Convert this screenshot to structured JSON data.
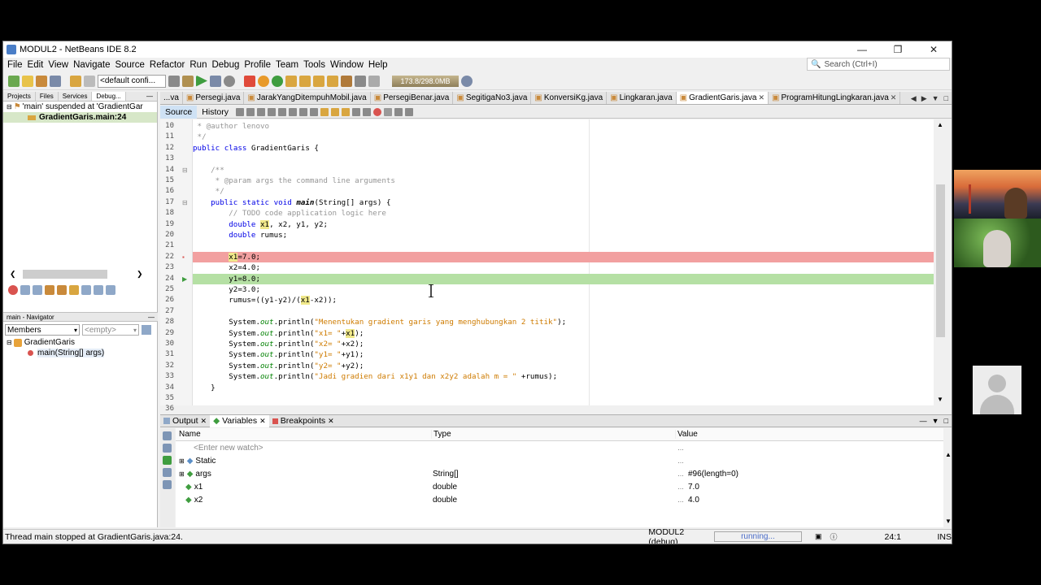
{
  "window": {
    "title": "MODUL2 - NetBeans IDE 8.2",
    "controls": [
      "—",
      "❐",
      "✕"
    ]
  },
  "menu": [
    "File",
    "Edit",
    "View",
    "Navigate",
    "Source",
    "Refactor",
    "Run",
    "Debug",
    "Profile",
    "Team",
    "Tools",
    "Window",
    "Help"
  ],
  "search": {
    "placeholder": "Search (Ctrl+I)"
  },
  "toolbar": {
    "config": "<default confi...",
    "memory": "173.8/298.0MB"
  },
  "left_panel": {
    "tabs": [
      "Projects",
      "Files",
      "Services",
      "Debug..."
    ],
    "debug_items": [
      "'main' suspended at 'GradientGar",
      "GradientGaris.main:24"
    ],
    "navigator_title": "main - Navigator",
    "members_label": "Members",
    "filter_placeholder": "<empty>",
    "nav_items": [
      "GradientGaris",
      "main(String[] args)"
    ]
  },
  "editor": {
    "tabs": [
      {
        "label": "...va",
        "active": false
      },
      {
        "label": "Persegi.java",
        "active": false
      },
      {
        "label": "JarakYangDitempuhMobil.java",
        "active": false
      },
      {
        "label": "PersegiBenar.java",
        "active": false
      },
      {
        "label": "SegitigaNo3.java",
        "active": false
      },
      {
        "label": "KonversiKg.java",
        "active": false
      },
      {
        "label": "Lingkaran.java",
        "active": false
      },
      {
        "label": "GradientGaris.java",
        "active": true
      },
      {
        "label": "ProgramHitungLingkaran.java",
        "active": false
      }
    ],
    "source_tab": "Source",
    "history_tab": "History",
    "line_numbers": [
      "10",
      "11",
      "12",
      "13",
      "14",
      "15",
      "16",
      "17",
      "18",
      "19",
      "20",
      "21",
      "22",
      "23",
      "24",
      "25",
      "26",
      "27",
      "28",
      "29",
      "30",
      "31",
      "32",
      "33",
      "34",
      "35",
      "36"
    ],
    "breakpoint_line": 22,
    "current_line": 24,
    "code_lines": [
      " * @author lenovo",
      " */",
      "public class GradientGaris {",
      "",
      "    /**",
      "     * @param args the command line arguments",
      "     */",
      "    public static void main(String[] args) {",
      "        // TODO code application logic here",
      "        double x1, x2, y1, y2;",
      "        double rumus;",
      "",
      "        x1=7.0;",
      "        x2=4.0;",
      "        y1=8.0;",
      "        y2=3.0;",
      "        rumus=((y1-y2)/(x1-x2));",
      "",
      "        System.out.println(\"Menentukan gradient garis yang menghubungkan 2 titik\");",
      "        System.out.println(\"x1= \"+x1);",
      "        System.out.println(\"x2= \"+x2);",
      "        System.out.println(\"y1= \"+y1);",
      "        System.out.println(\"y2= \"+y2);",
      "        System.out.println(\"Jadi gradien dari x1y1 dan x2y2 adalah m = \" +rumus);",
      "    }",
      "",
      "}"
    ]
  },
  "bottom_panel": {
    "tabs": [
      {
        "label": "Output",
        "active": false
      },
      {
        "label": "Variables",
        "active": true
      },
      {
        "label": "Breakpoints",
        "active": false
      }
    ],
    "columns": [
      "Name",
      "Type",
      "Value"
    ],
    "watch_placeholder": "<Enter new watch>",
    "rows": [
      {
        "name": "Static",
        "type": "",
        "value": ""
      },
      {
        "name": "args",
        "type": "String[]",
        "value": "#96(length=0)"
      },
      {
        "name": "x1",
        "type": "double",
        "value": "7.0"
      },
      {
        "name": "x2",
        "type": "double",
        "value": "4.0"
      }
    ]
  },
  "status": {
    "message": "Thread main stopped at GradientGaris.java:24.",
    "project": "MODUL2 (debug)",
    "running": "running...",
    "position": "24:1",
    "mode": "INS"
  },
  "colors": {
    "breakpoint_bg": "#f2a0a0",
    "current_line_bg": "#b5e0a4",
    "keyword": "#0000e6",
    "comment": "#969696",
    "string": "#ce7b00"
  }
}
